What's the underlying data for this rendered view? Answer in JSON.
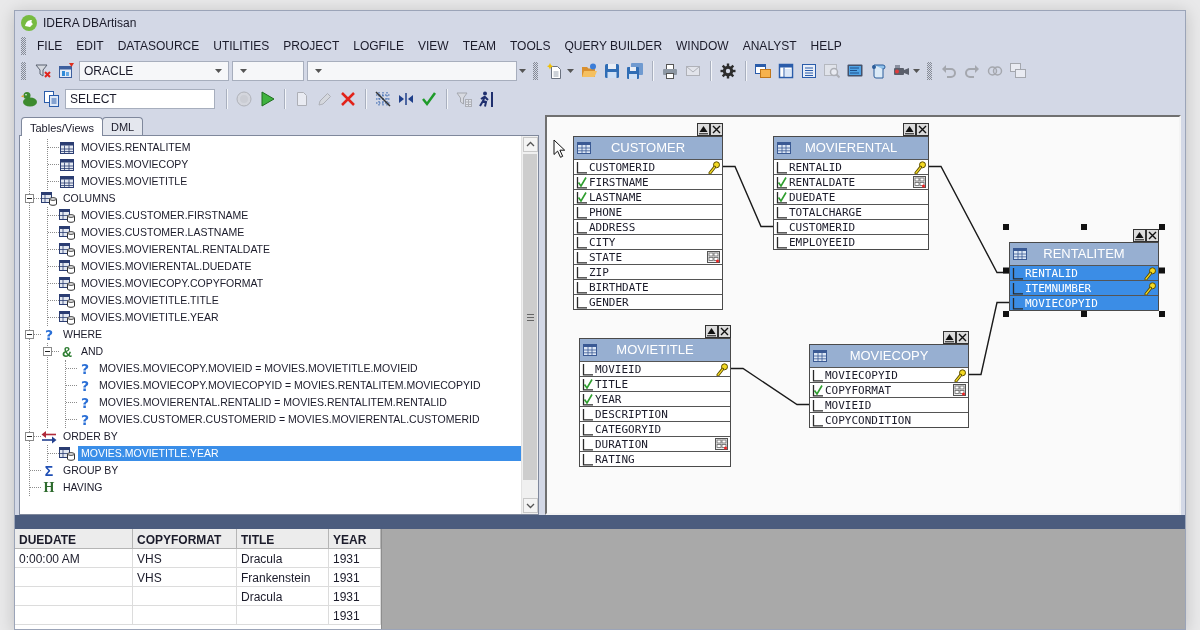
{
  "window": {
    "title": "IDERA DBArtisan"
  },
  "menu": [
    "FILE",
    "EDIT",
    "DATASOURCE",
    "UTILITIES",
    "PROJECT",
    "LOGFILE",
    "VIEW",
    "TEAM",
    "TOOLS",
    "QUERY BUILDER",
    "WINDOW",
    "ANALYST",
    "HELP"
  ],
  "toolbars": [
    {
      "items": [
        {
          "kind": "grip"
        },
        {
          "kind": "funnel-x",
          "disabled": false
        },
        {
          "kind": "datasource",
          "disabled": false
        },
        {
          "kind": "select",
          "value": "ORACLE"
        },
        {
          "kind": "select"
        },
        {
          "kind": "select"
        },
        {
          "kind": "overflow"
        },
        {
          "kind": "grip"
        },
        {
          "kind": "new",
          "disabled": false
        },
        {
          "kind": "open",
          "disabled": false
        },
        {
          "kind": "save",
          "disabled": false
        },
        {
          "kind": "save-all",
          "disabled": false
        },
        {
          "kind": "separator"
        },
        {
          "kind": "print",
          "disabled": false
        },
        {
          "kind": "mail",
          "disabled": true
        },
        {
          "kind": "separator"
        },
        {
          "kind": "gear",
          "disabled": false
        },
        {
          "kind": "separator"
        },
        {
          "kind": "cascade",
          "disabled": false
        },
        {
          "kind": "layout",
          "disabled": false
        },
        {
          "kind": "list",
          "disabled": false
        },
        {
          "kind": "find",
          "disabled": true
        },
        {
          "kind": "monitor",
          "disabled": false
        },
        {
          "kind": "scroll",
          "disabled": false
        },
        {
          "kind": "camera",
          "disabled": false
        },
        {
          "kind": "grip"
        },
        {
          "kind": "undo",
          "disabled": true
        },
        {
          "kind": "redo",
          "disabled": true
        },
        {
          "kind": "rings",
          "disabled": true
        },
        {
          "kind": "windows",
          "disabled": true
        }
      ]
    },
    {
      "items": [
        {
          "kind": "duck",
          "disabled": false
        },
        {
          "kind": "copy",
          "disabled": false
        },
        {
          "kind": "field",
          "value": "SELECT"
        },
        {
          "kind": "separator"
        },
        {
          "kind": "stop",
          "disabled": true
        },
        {
          "kind": "play",
          "disabled": false
        },
        {
          "kind": "separator"
        },
        {
          "kind": "document",
          "disabled": true
        },
        {
          "kind": "pencil",
          "disabled": true
        },
        {
          "kind": "delete",
          "disabled": false
        },
        {
          "kind": "separator"
        },
        {
          "kind": "grid",
          "disabled": false
        },
        {
          "kind": "join",
          "disabled": false
        },
        {
          "kind": "check",
          "disabled": false
        },
        {
          "kind": "separator"
        },
        {
          "kind": "filter",
          "disabled": true
        },
        {
          "kind": "walker",
          "disabled": false
        }
      ]
    }
  ],
  "tree_panel": {
    "tabs": [
      {
        "label": "Tables/Views",
        "selected": true
      },
      {
        "label": "DML",
        "selected": false
      }
    ],
    "tree": [
      {
        "children": [
          {
            "label": "MOVIES.RENTALITEM",
            "kind": "table",
            "selected": false
          },
          {
            "label": "MOVIES.MOVIECOPY",
            "kind": "table",
            "selected": false
          },
          {
            "label": "MOVIES.MOVIETITLE",
            "kind": "table",
            "selected": false
          }
        ]
      },
      {
        "label": "COLUMNS",
        "kind": "columns",
        "expanded": true,
        "selected": false,
        "children": [
          {
            "label": "MOVIES.CUSTOMER.FIRSTNAME",
            "kind": "column",
            "selected": false
          },
          {
            "label": "MOVIES.CUSTOMER.LASTNAME",
            "kind": "column",
            "selected": false
          },
          {
            "label": "MOVIES.MOVIERENTAL.RENTALDATE",
            "kind": "column",
            "selected": false
          },
          {
            "label": "MOVIES.MOVIERENTAL.DUEDATE",
            "kind": "column",
            "selected": false
          },
          {
            "label": "MOVIES.MOVIECOPY.COPYFORMAT",
            "kind": "column",
            "selected": false
          },
          {
            "label": "MOVIES.MOVIETITLE.TITLE",
            "kind": "column",
            "selected": false
          },
          {
            "label": "MOVIES.MOVIETITLE.YEAR",
            "kind": "column",
            "selected": false
          }
        ]
      },
      {
        "label": "WHERE",
        "kind": "where",
        "glyph": "?",
        "expanded": true,
        "selected": false,
        "children": [
          {
            "label": "AND",
            "kind": "and",
            "glyph": "&",
            "expanded": true,
            "selected": false,
            "children": [
              {
                "label": "MOVIES.MOVIECOPY.MOVIEID = MOVIES.MOVIETITLE.MOVIEID",
                "kind": "condition",
                "glyph": "?",
                "selected": false
              },
              {
                "label": "MOVIES.MOVIECOPY.MOVIECOPYID = MOVIES.RENTALITEM.MOVIECOPYID",
                "kind": "condition",
                "glyph": "?",
                "selected": false
              },
              {
                "label": "MOVIES.MOVIERENTAL.RENTALID = MOVIES.RENTALITEM.RENTALID",
                "kind": "condition",
                "glyph": "?",
                "selected": false
              },
              {
                "label": "MOVIES.CUSTOMER.CUSTOMERID = MOVIES.MOVIERENTAL.CUSTOMERID",
                "kind": "condition",
                "glyph": "?",
                "selected": false
              }
            ]
          }
        ]
      },
      {
        "label": "ORDER BY",
        "kind": "order",
        "expanded": true,
        "selected": false,
        "children": [
          {
            "label": "MOVIES.MOVIETITLE.YEAR",
            "kind": "column",
            "selected": true
          }
        ]
      },
      {
        "label": "GROUP BY",
        "kind": "group",
        "glyph": "Σ",
        "selected": false
      },
      {
        "label": "HAVING",
        "kind": "having",
        "glyph": "H",
        "selected": false
      }
    ]
  },
  "diagram": {
    "tables": [
      {
        "name": "CUSTOMER",
        "selected": false,
        "columns": [
          {
            "name": "CUSTOMERID",
            "checked": false,
            "key": true,
            "indexed": false
          },
          {
            "name": "FIRSTNAME",
            "checked": true,
            "key": false,
            "indexed": false
          },
          {
            "name": "LASTNAME",
            "checked": true,
            "key": false,
            "indexed": false
          },
          {
            "name": "PHONE",
            "checked": false,
            "key": false,
            "indexed": false
          },
          {
            "name": "ADDRESS",
            "checked": false,
            "key": false,
            "indexed": false
          },
          {
            "name": "CITY",
            "checked": false,
            "key": false,
            "indexed": false
          },
          {
            "name": "STATE",
            "checked": false,
            "key": false,
            "indexed": true
          },
          {
            "name": "ZIP",
            "checked": false,
            "key": false,
            "indexed": false
          },
          {
            "name": "BIRTHDATE",
            "checked": false,
            "key": false,
            "indexed": false
          },
          {
            "name": "GENDER",
            "checked": false,
            "key": false,
            "indexed": false
          }
        ]
      },
      {
        "name": "MOVIERENTAL",
        "selected": false,
        "columns": [
          {
            "name": "RENTALID",
            "checked": false,
            "key": true,
            "indexed": false
          },
          {
            "name": "RENTALDATE",
            "checked": true,
            "key": false,
            "indexed": true
          },
          {
            "name": "DUEDATE",
            "checked": true,
            "key": false,
            "indexed": false
          },
          {
            "name": "TOTALCHARGE",
            "checked": false,
            "key": false,
            "indexed": false
          },
          {
            "name": "CUSTOMERID",
            "checked": false,
            "key": false,
            "indexed": false
          },
          {
            "name": "EMPLOYEEID",
            "checked": false,
            "key": false,
            "indexed": false
          }
        ]
      },
      {
        "name": "RENTALITEM",
        "selected": true,
        "columns": [
          {
            "name": "RENTALID",
            "checked": false,
            "key": true,
            "indexed": false
          },
          {
            "name": "ITEMNUMBER",
            "checked": false,
            "key": true,
            "indexed": false
          },
          {
            "name": "MOVIECOPYID",
            "checked": false,
            "key": false,
            "indexed": false
          }
        ]
      },
      {
        "name": "MOVIECOPY",
        "selected": false,
        "columns": [
          {
            "name": "MOVIECOPYID",
            "checked": false,
            "key": true,
            "indexed": false
          },
          {
            "name": "COPYFORMAT",
            "checked": true,
            "key": false,
            "indexed": true
          },
          {
            "name": "MOVIEID",
            "checked": false,
            "key": false,
            "indexed": false
          },
          {
            "name": "COPYCONDITION",
            "checked": false,
            "key": false,
            "indexed": false
          }
        ]
      },
      {
        "name": "MOVIETITLE",
        "selected": false,
        "columns": [
          {
            "name": "MOVIEID",
            "checked": false,
            "key": true,
            "indexed": false
          },
          {
            "name": "TITLE",
            "checked": true,
            "key": false,
            "indexed": false
          },
          {
            "name": "YEAR",
            "checked": true,
            "key": false,
            "indexed": false
          },
          {
            "name": "DESCRIPTION",
            "checked": false,
            "key": false,
            "indexed": false
          },
          {
            "name": "CATEGORYID",
            "checked": false,
            "key": false,
            "indexed": false
          },
          {
            "name": "DURATION",
            "checked": false,
            "key": false,
            "indexed": true
          },
          {
            "name": "RATING",
            "checked": false,
            "key": false,
            "indexed": false
          }
        ]
      }
    ]
  },
  "results": {
    "columns": [
      "DUEDATE",
      "COPYFORMAT",
      "TITLE",
      "YEAR"
    ],
    "rows": [
      {
        "cells": [
          "0:00:00 AM",
          "VHS",
          "Dracula",
          "1931"
        ]
      },
      {
        "cells": [
          null,
          "VHS",
          "Frankenstein",
          "1931"
        ]
      },
      {
        "cells": [
          null,
          null,
          "Dracula",
          "1931"
        ]
      },
      {
        "cells": [
          null,
          null,
          null,
          "1931"
        ]
      }
    ]
  }
}
